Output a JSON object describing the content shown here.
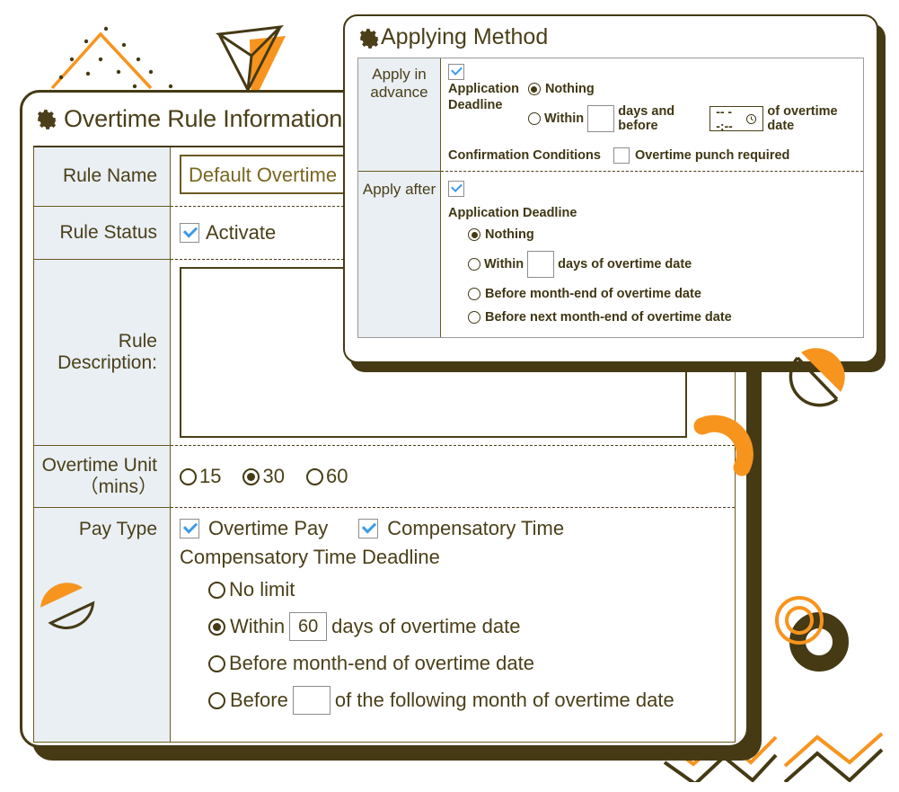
{
  "colors": {
    "dark_brown": "#453a14",
    "label_bg": "#e9eff3",
    "accent_orange": "#f7941e",
    "field_text": "#7a6620",
    "check_blue": "#3d9be9"
  },
  "main_dialog": {
    "icon": "gear-icon",
    "title": "Overtime Rule Information",
    "rows": {
      "rule_name": {
        "label": "Rule Name",
        "value": "Default Overtime",
        "placeholder": "Rule Name"
      },
      "rule_status": {
        "label": "Rule Status",
        "checkbox_label": "Activate",
        "checked": true
      },
      "rule_description": {
        "label": "Rule Description:",
        "value": "",
        "placeholder": ""
      },
      "overtime_unit": {
        "label": "Overtime Unit（mins）",
        "options": [
          {
            "label": "15",
            "selected": false
          },
          {
            "label": "30",
            "selected": true
          },
          {
            "label": "60",
            "selected": false
          }
        ]
      },
      "pay_type": {
        "label": "Pay Type",
        "checkboxes": [
          {
            "label": "Overtime Pay",
            "checked": true
          },
          {
            "label": "Compensatory Time",
            "checked": true
          }
        ],
        "deadline_heading": "Compensatory Time Deadline",
        "deadline_options": [
          {
            "label": "No limit",
            "selected": false
          },
          {
            "prefix": "Within",
            "value": "60",
            "suffix": "days of overtime date",
            "selected": true
          },
          {
            "label": "Before month-end of overtime date",
            "selected": false
          },
          {
            "prefix": "Before",
            "value": "",
            "suffix": "of the following month of overtime date",
            "selected": false
          }
        ]
      }
    }
  },
  "applying_method_dialog": {
    "icon": "gear-icon",
    "title": "Applying Method",
    "apply_in_advance": {
      "label": "Apply in advance",
      "enabled": true,
      "deadline_label": "Application Deadline",
      "options": [
        {
          "label": "Nothing",
          "selected": true
        },
        {
          "prefix": "Within",
          "days_value": "",
          "mid": "days and before",
          "time_value": "-- --:--",
          "time_icon": "clock-icon",
          "suffix": "of overtime date",
          "selected": false
        }
      ],
      "confirmation_label": "Confirmation Conditions",
      "confirmation_checkbox": {
        "label": "Overtime punch required",
        "checked": false
      }
    },
    "apply_after": {
      "label": "Apply after",
      "enabled": true,
      "deadline_label": "Application Deadline",
      "options": [
        {
          "label": "Nothing",
          "selected": true
        },
        {
          "prefix": "Within",
          "value": "",
          "suffix": "days of overtime date",
          "selected": false
        },
        {
          "label": "Before month-end of overtime date",
          "selected": false
        },
        {
          "label": "Before next month-end of overtime date",
          "selected": false
        }
      ]
    }
  }
}
